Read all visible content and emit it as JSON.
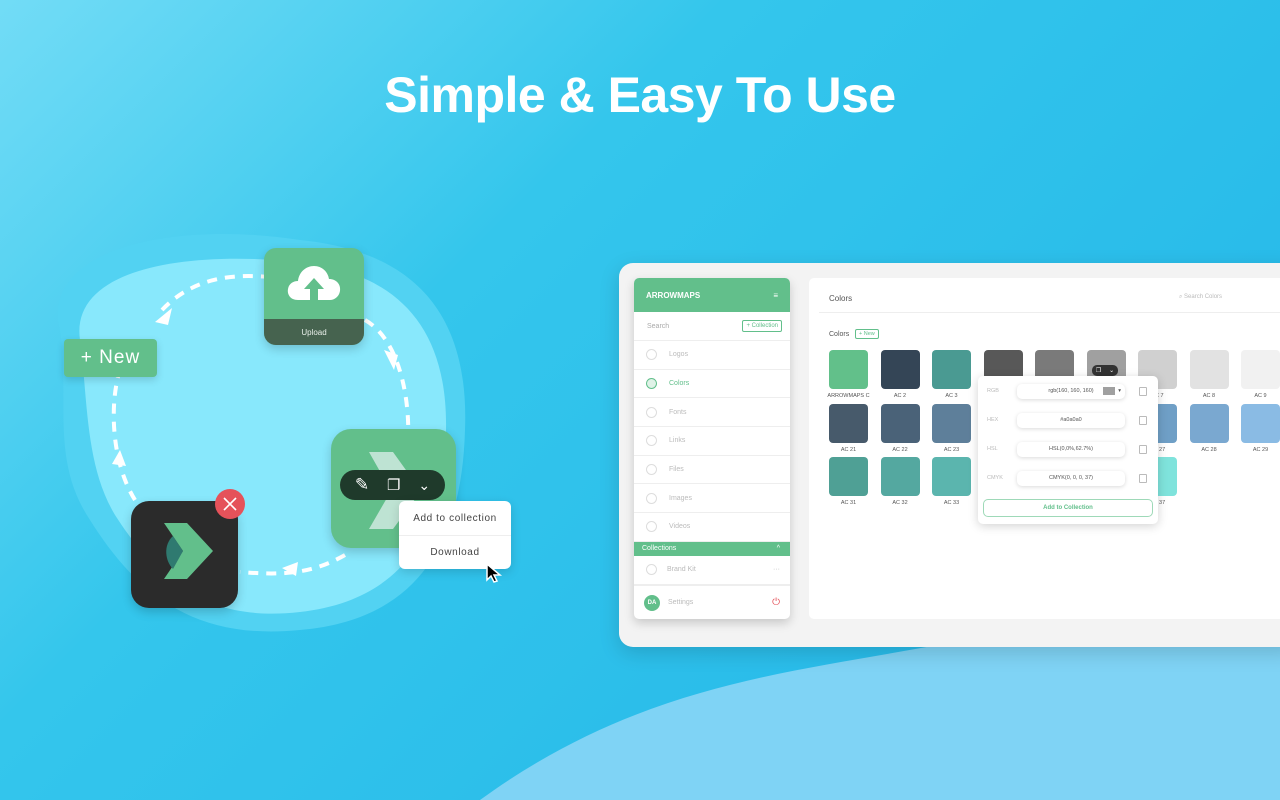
{
  "headline": "Simple & Easy To Use",
  "illustration": {
    "new_button": "+ New",
    "upload_label": "Upload",
    "menu": [
      "Add to collection",
      "Download"
    ],
    "icons": [
      "cloud-upload-icon",
      "close-icon",
      "pencil-icon",
      "copy-icon",
      "chevron-down-icon",
      "cursor-icon"
    ]
  },
  "app": {
    "brand": "ARROWMAPS",
    "search_placeholder": "Search",
    "collection_button": "+ Collection",
    "nav": [
      {
        "label": "Logos",
        "active": false
      },
      {
        "label": "Colors",
        "active": true
      },
      {
        "label": "Fonts",
        "active": false
      },
      {
        "label": "Links",
        "active": false
      },
      {
        "label": "Files",
        "active": false
      },
      {
        "label": "Images",
        "active": false
      },
      {
        "label": "Videos",
        "active": false
      }
    ],
    "collections_header": "Collections",
    "collections": [
      {
        "label": "Brand Kit",
        "more": "···"
      }
    ],
    "avatar_initials": "DA",
    "settings": "Settings",
    "main_title": "Colors",
    "search_colors_placeholder": "Search Colors",
    "section_title": "Colors",
    "new_button": "+ New",
    "accent": "#62bf8b",
    "swatches": [
      [
        {
          "label": "ARROWMAPS C",
          "color": "#62c08a"
        },
        {
          "label": "AC 2",
          "color": "#344556"
        },
        {
          "label": "AC 3",
          "color": "#4a9a92"
        },
        {
          "label": "",
          "color": "#585858"
        },
        {
          "label": "",
          "color": "#7a7a7a"
        },
        {
          "label": "",
          "color": "#a0a0a0"
        },
        {
          "label": "AC 7",
          "color": "#d0d0d0"
        },
        {
          "label": "AC 8",
          "color": "#e2e2e2"
        },
        {
          "label": "AC 9",
          "color": "#f1f1f1"
        }
      ],
      [
        {
          "label": "AC 21",
          "color": "#475a6b"
        },
        {
          "label": "AC 22",
          "color": "#4a6278"
        },
        {
          "label": "AC 23",
          "color": "#5e7f9a"
        },
        {
          "label": "",
          "color": "#5e8aaa"
        },
        {
          "label": "",
          "color": "#6593b8"
        },
        {
          "label": "",
          "color": "#6a9ac0"
        },
        {
          "label": "AC 27",
          "color": "#6f9fc6"
        },
        {
          "label": "AC 28",
          "color": "#7aa8d0"
        },
        {
          "label": "AC 29",
          "color": "#8abbe4"
        }
      ],
      [
        {
          "label": "AC 31",
          "color": "#4fa095"
        },
        {
          "label": "AC 32",
          "color": "#54a8a0"
        },
        {
          "label": "AC 33",
          "color": "#5bb5ae"
        },
        {
          "label": "",
          "color": "#65c4bd"
        },
        {
          "label": "",
          "color": "#6dd1ca"
        },
        {
          "label": "",
          "color": "#75dad3"
        },
        {
          "label": "AC 37",
          "color": "#7fe3dc"
        }
      ]
    ],
    "popup": {
      "rows": [
        {
          "label": "RGB",
          "value": "rgb(160, 160, 160)"
        },
        {
          "label": "HEX",
          "value": "#a0a0a0"
        },
        {
          "label": "HSL",
          "value": "HSL(0,0%,62.7%)"
        },
        {
          "label": "CMYK",
          "value": "CMYK(0, 0, 0, 37)"
        }
      ],
      "add_button": "Add to Collection"
    }
  }
}
